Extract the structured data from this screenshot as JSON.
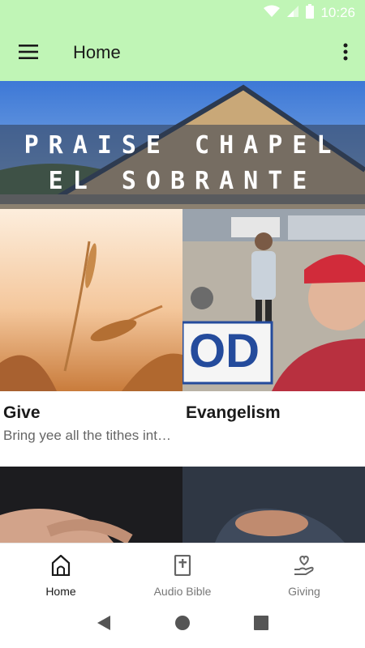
{
  "status_bar": {
    "time": "10:26",
    "icons": [
      "wifi-icon",
      "signal-icon",
      "battery-icon"
    ]
  },
  "app_bar": {
    "title": "Home",
    "menu_icon": "hamburger-menu-icon",
    "overflow_icon": "more-vertical-icon",
    "background": "#c0f5b6"
  },
  "banner": {
    "line1": "PRAISE CHAPEL",
    "line2": "EL SOBRANTE"
  },
  "cards": [
    {
      "title": "Give",
      "subtitle": "Bring yee all the tithes into the storehouse"
    },
    {
      "title": "Evangelism",
      "subtitle": ""
    }
  ],
  "bottom_nav": {
    "items": [
      {
        "label": "Home",
        "icon": "church-icon",
        "active": true
      },
      {
        "label": "Audio Bible",
        "icon": "bible-icon",
        "active": false
      },
      {
        "label": "Giving",
        "icon": "heart-hand-icon",
        "active": false
      }
    ]
  },
  "system_nav": {
    "icons": [
      "back-icon",
      "home-circle-icon",
      "recents-square-icon"
    ]
  }
}
